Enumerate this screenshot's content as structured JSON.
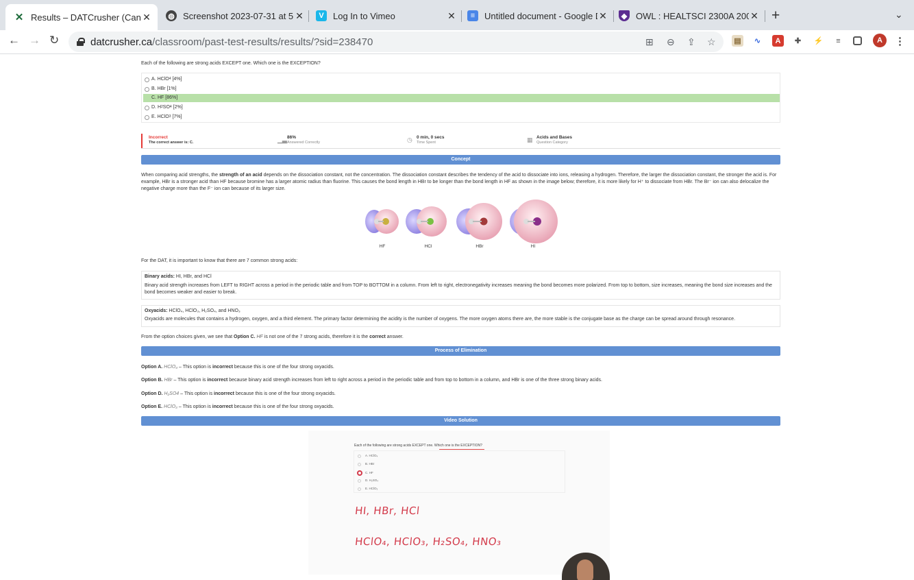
{
  "browser": {
    "tabs": [
      {
        "title": "Results – DATCrusher (Canadian",
        "icon": "datcrusher-icon",
        "active": true
      },
      {
        "title": "Screenshot 2023-07-31 at 5.0",
        "icon": "globe-icon",
        "active": false
      },
      {
        "title": "Log In to Vimeo",
        "icon": "vimeo-icon",
        "active": false
      },
      {
        "title": "Untitled document - Google Do",
        "icon": "google-docs-icon",
        "active": false
      },
      {
        "title": "OWL : HEALTSCI 2300A 200 S",
        "icon": "owl-shield-icon",
        "active": false
      }
    ],
    "url_host": "datcrusher.ca",
    "url_path": "/classroom/past-test-results/results/?sid=238470",
    "profile_initial": "A"
  },
  "question": {
    "text": "Each of the following are strong acids EXCEPT one. Which one is the EXCEPTION?",
    "options": [
      {
        "letter": "A.",
        "text": "HClO",
        "sub": "4",
        "pct": "[4%]",
        "correct": false
      },
      {
        "letter": "B.",
        "text": "HBr",
        "sub": "",
        "pct": "[1%]",
        "correct": false
      },
      {
        "letter": "C.",
        "text": "HF",
        "sub": "",
        "pct": "[86%]",
        "correct": true
      },
      {
        "letter": "D.",
        "text": "H",
        "sub": "2",
        "text2": "SO",
        "sub2": "4",
        "pct": "[2%]",
        "correct": false
      },
      {
        "letter": "E.",
        "text": "HClO",
        "sub": "3",
        "pct": "[7%]",
        "correct": false
      }
    ]
  },
  "stats": {
    "result": "Incorrect",
    "result_detail": "The correct answer is: C.",
    "answered_correctly_value": "86%",
    "answered_correctly_label": "Answered Correctly",
    "time_value": "0 min, 0 secs",
    "time_label": "Time Spent",
    "category_value": "Acids and Bases",
    "category_label": "Question Category",
    "status_color": "#e53935"
  },
  "concept": {
    "banner": "Concept",
    "p1_a": "When comparing acid strengths, the ",
    "p1_bold": "strength of an acid",
    "p1_b": " depends on the dissociation constant, not the concentration. The dissociation constant describes the tendency of the acid to dissociate into ions, releasing a hydrogen. Therefore, the larger the dissociation constant, the stronger the acid is. For example, HBr is a stronger acid than HF because bromine has a larger atomic radius than fluorine. This causes the bond length in HBr to be longer than the bond length in HF as shown in the image below; therefore, it is more likely for H⁺ to dissociate from HBr. The Br⁻ ion can also delocalize the negative charge more than the F⁻ ion can because of its larger size.",
    "molecules": [
      "HF",
      "HCl",
      "HBr",
      "HI"
    ],
    "p2": "For the DAT, it is important to know that there are 7 common strong acids:",
    "binary_title": "Binary acids:",
    "binary_list": " HI, HBr, and HCl",
    "binary_text": "Binary acid strength increases from LEFT to RIGHT across a period in the periodic table and from TOP to BOTTOM in a column. From left to right, electronegativity increases meaning the bond becomes more polarized. From top to bottom, size increases, meaning the bond size increases and the bond becomes weaker and easier to break.",
    "oxy_title": "Oxyacids:",
    "oxy_list": " HClO₄, HClO₃, H₂SO₄, and HNO₃",
    "oxy_text": "Oxyacids are molecules that contains a hydrogen, oxygen, and a third element. The primary factor determining the acidity is the number of oxygens. The more oxygen atoms there are, the more stable is the conjugate base as the charge can be spread around through resonance.",
    "conclusion_a": "From the option choices given, we see that ",
    "conclusion_opt": "Option C.",
    "conclusion_hf": " HF",
    "conclusion_b": " is not one of the 7 strong acids, therefore it is the ",
    "conclusion_bold": "correct",
    "conclusion_c": " answer."
  },
  "elimination": {
    "banner": "Process of Elimination",
    "items": [
      {
        "label": "Option A.",
        "formula": " HClO₄",
        "a": " – This option is ",
        "b": "incorrect",
        "c": " because this is one of the four strong oxyacids."
      },
      {
        "label": "Option B.",
        "formula": " HBr",
        "a": " – This option is ",
        "b": "incorrect",
        "c": " because binary acid strength increases from left to right across a period in the periodic table and from top to bottom in a column, and HBr is one of the three strong binary acids."
      },
      {
        "label": "Option D.",
        "formula": " H₂SO4",
        "a": " – This option is ",
        "b": "incorrect",
        "c": " because this is one of the four strong oxyacids."
      },
      {
        "label": "Option E.",
        "formula": " HClO₃",
        "a": " – This option is ",
        "b": "incorrect",
        "c": " because this is one of the four strong oxyacids."
      }
    ]
  },
  "video": {
    "banner": "Video Solution",
    "question": "Each of the following are strong acids EXCEPT one. Which one is the EXCEPTION?",
    "options": [
      "A. HClO₄",
      "B. HBr",
      "C. HF",
      "D. H₂SO₄",
      "E. HClO₃"
    ],
    "handwriting_1": "HI, HBr, HCl",
    "handwriting_2": "HClO₄, HClO₃, H₂SO₄, HNO₃",
    "ink_color": "#d33a4a"
  }
}
